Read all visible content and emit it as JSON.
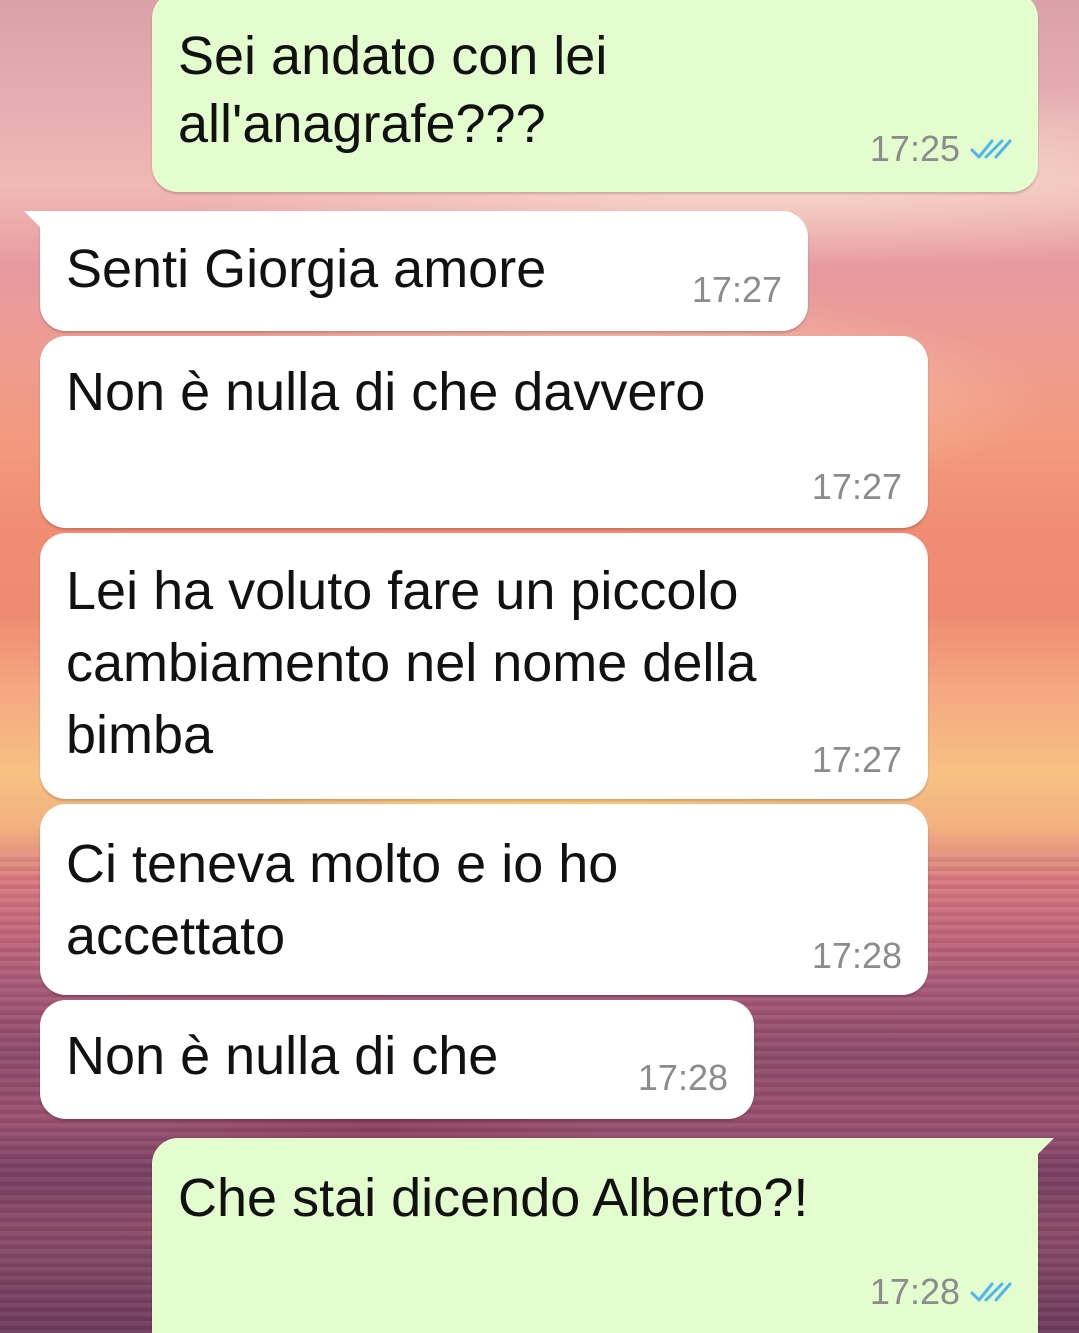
{
  "conversation": {
    "messages": [
      {
        "direction": "outgoing",
        "text": "Sei andato con lei\nall'anagrafe???",
        "time": "17:25",
        "status": "read-double-check-icon"
      },
      {
        "direction": "incoming",
        "text": "Senti Giorgia amore",
        "time": "17:27"
      },
      {
        "direction": "incoming",
        "text": "Non è nulla di che davvero",
        "time": "17:27"
      },
      {
        "direction": "incoming",
        "text": "Lei ha voluto fare un piccolo\ncambiamento nel nome della\nbimba",
        "time": "17:27"
      },
      {
        "direction": "incoming",
        "text": "Ci teneva molto e io ho\naccettato",
        "time": "17:28"
      },
      {
        "direction": "incoming",
        "text": "Non è nulla di che",
        "time": "17:28"
      },
      {
        "direction": "outgoing",
        "text": "Che stai dicendo Alberto?!",
        "time": "17:28",
        "status": "read-double-check-icon"
      }
    ]
  },
  "colors": {
    "incoming_bubble": "#ffffff",
    "outgoing_bubble": "#e3fdcf",
    "read_ticks": "#4fb6ec",
    "timestamp": "#8c8c8c"
  }
}
